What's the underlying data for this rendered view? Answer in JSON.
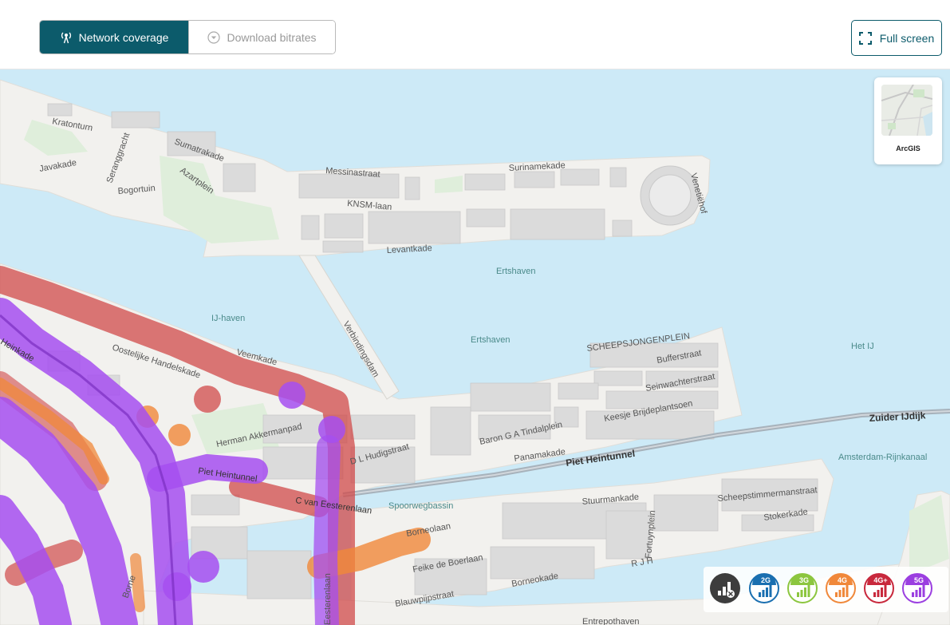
{
  "toolbar": {
    "network_coverage_label": "Network coverage",
    "download_bitrates_label": "Download bitrates",
    "fullscreen_label": "Full screen",
    "active_color": "#0c5b6b"
  },
  "basemap": {
    "label": "ArcGIS"
  },
  "map_labels": {
    "kratonturn": "Kratonturn",
    "seranggracht": "Seranggracht",
    "javakade": "Javakade",
    "bogortuin": "Bogortuin",
    "sumatrakade": "Sumatrakade",
    "azartplein": "Azartplein",
    "messinastraat": "Messinastraat",
    "surinamekade": "Surinamekade",
    "knsm_laan": "KNSM-laan",
    "levantkade": "Levantkade",
    "venetiehof": "Venetiëhof",
    "ertshaven_1": "Ertshaven",
    "ertshaven_2": "Ertshaven",
    "ij_haven": "IJ-haven",
    "verbindingsdam": "Verbindingsdam",
    "het_ij": "Het IJ",
    "scheepsjongenplein": "SCHEEPSJONGENPLEIN",
    "bufferstraat": "Bufferstraat",
    "seinwachterstraat": "Seinwachterstraat",
    "keesje_brijdeplantsoen": "Keesje Brijdeplantsoen",
    "baron_tindalplein": "Baron G A  Tindalplein",
    "panamakade": "Panamakade",
    "piet_heintunnel_1": "Piet  Heintunnel",
    "piet_heintunnel_2": "Piet  Heintunnel",
    "zuider_ijdijk": "Zuider IJdijk",
    "amsterdam_rijnkanaal": "Amsterdam-Rijnkanaal",
    "oostelijke_handelskade": "Oostelijke Handelskade",
    "veemkade": "Veemkade",
    "heinkade": "Heinkade",
    "herman_akkermanpad": "Herman Akkermanpad",
    "dl_hudigstraat": "D L  Hudigstraat",
    "c_van_eesterenlaan": "C  van Eesterenlaan",
    "spoorwegbassin": "Spoorwegbassin",
    "stuurmankade": "Stuurmankade",
    "scheepstimmermanstraat": "Scheepstimmermanstraat",
    "stokerkade": "Stokerkade",
    "fortuynplein": "Fortuynplein",
    "borneolaan": "Borneolaan",
    "feike_de_boerlaan": "Feike de Boerlaan",
    "rjh": "R J H",
    "borneokade": "Borneokade",
    "blauwpijpstraat": "Blauwpijpstraat",
    "entrepothaven": "Entrepothaven",
    "bornee": "Borne",
    "eesterenlaan_v": "Eesterenlaan"
  },
  "legend": {
    "items": [
      {
        "id": "none",
        "label": "",
        "icon": "no-signal-icon",
        "color": "#3d3d3d"
      },
      {
        "id": "2g",
        "label": "2G",
        "icon": "signal-bars-icon",
        "color": "#1a6fb0"
      },
      {
        "id": "3g",
        "label": "3G",
        "icon": "signal-bars-icon",
        "color": "#8cc63f"
      },
      {
        "id": "4g",
        "label": "4G",
        "icon": "signal-bars-icon",
        "color": "#f0883a"
      },
      {
        "id": "4gplus",
        "label": "4G+",
        "icon": "signal-bars-icon",
        "color": "#c8283c"
      },
      {
        "id": "5g",
        "label": "5G",
        "icon": "signal-bars-icon",
        "color": "#9b3fe0"
      }
    ]
  },
  "coverage_colors": {
    "4g": "#f0883a",
    "4gplus": "#d04a4a",
    "5g": "#a64ff0"
  }
}
